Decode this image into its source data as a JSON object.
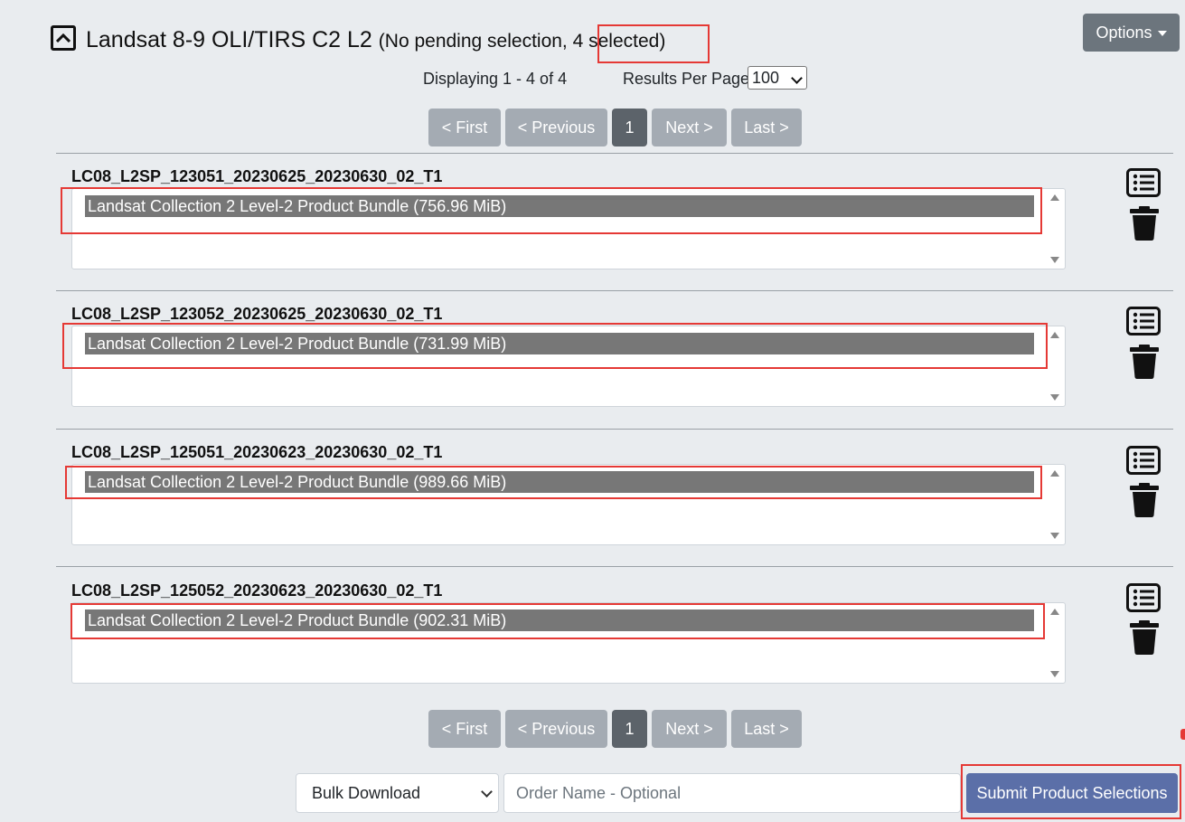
{
  "header": {
    "title": "Landsat 8-9 OLI/TIRS C2 L2",
    "selection_prefix": "(No pending selection, ",
    "selection_count": "4 selected)",
    "options_label": "Options"
  },
  "paging": {
    "displaying": "Displaying 1 - 4 of 4",
    "results_per_page_label": "Results Per Page:",
    "results_per_page_value": "100",
    "first": "< First",
    "previous": "< Previous",
    "current_page": "1",
    "next": "Next >",
    "last": "Last >"
  },
  "scenes": [
    {
      "id": "LC08_L2SP_123051_20230625_20230630_02_T1",
      "product": "Landsat Collection 2 Level-2 Product Bundle (756.96 MiB)"
    },
    {
      "id": "LC08_L2SP_123052_20230625_20230630_02_T1",
      "product": "Landsat Collection 2 Level-2 Product Bundle (731.99 MiB)"
    },
    {
      "id": "LC08_L2SP_125051_20230623_20230630_02_T1",
      "product": "Landsat Collection 2 Level-2 Product Bundle (989.66 MiB)"
    },
    {
      "id": "LC08_L2SP_125052_20230623_20230630_02_T1",
      "product": "Landsat Collection 2 Level-2 Product Bundle (902.31 MiB)"
    }
  ],
  "footer": {
    "download_type": "Bulk Download",
    "order_name_placeholder": "Order Name - Optional",
    "submit_label": "Submit Product Selections"
  },
  "icons": {
    "collapse": "chevron-up-icon",
    "details": "list-details-icon",
    "remove": "trash-icon"
  },
  "colors": {
    "highlight": "#e53935",
    "options_button": "#6c757d",
    "submit_button": "#5b6fa8",
    "selected_option": "#777777"
  }
}
